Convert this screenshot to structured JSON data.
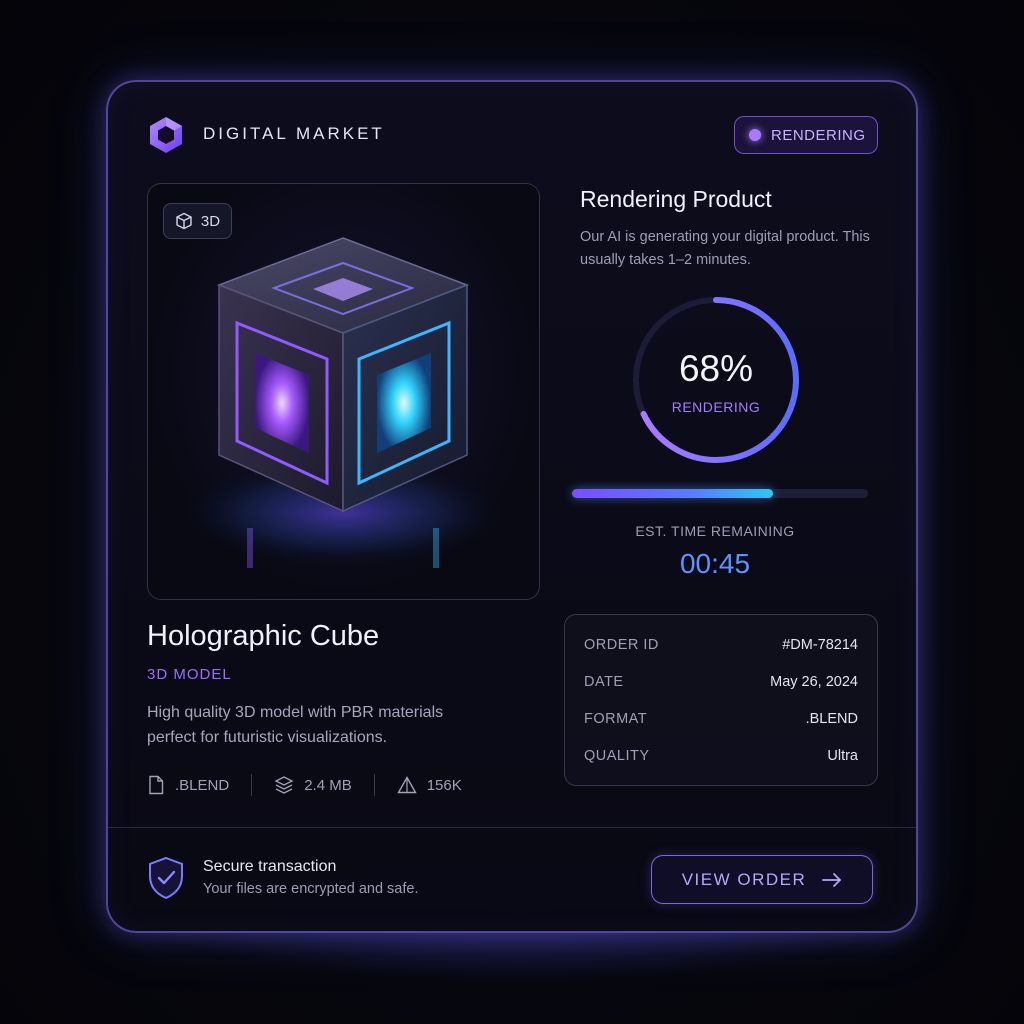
{
  "header": {
    "brand": "DIGITAL MARKET",
    "status_label": "RENDERING"
  },
  "preview": {
    "badge_label": "3D",
    "badge_icon": "cube-outline-icon"
  },
  "product": {
    "title": "Holographic Cube",
    "category": "3D MODEL",
    "description": "High quality 3D model with PBR materials perfect for futuristic visualizations.",
    "meta": [
      {
        "icon": "file-icon",
        "label": ".BLEND"
      },
      {
        "icon": "layers-icon",
        "label": "2.4 MB"
      },
      {
        "icon": "triangle-icon",
        "label": "156K"
      }
    ]
  },
  "render": {
    "title": "Rendering Product",
    "description": "Our AI is generating your digital product. This usually takes 1–2 minutes.",
    "progress_text": "68%",
    "progress": 0.68,
    "progress_label": "RENDERING",
    "bar_progress": 0.68,
    "eta_label": "EST. TIME REMAINING",
    "eta_value": "00:45"
  },
  "order": {
    "rows": [
      {
        "key": "ORDER ID",
        "value": "#DM-78214"
      },
      {
        "key": "DATE",
        "value": "May 26, 2024"
      },
      {
        "key": "FORMAT",
        "value": ".BLEND"
      },
      {
        "key": "QUALITY",
        "value": "Ultra"
      }
    ]
  },
  "footer": {
    "secure_title": "Secure transaction",
    "secure_subtitle": "Your files are encrypted and safe.",
    "button_label": "VIEW ORDER",
    "button_icon": "arrow-right-icon"
  },
  "colors": {
    "accent_purple": "#9d6bff",
    "accent_blue": "#5d93ff",
    "accent_cyan": "#2ec7f0",
    "background": "#06060d"
  }
}
